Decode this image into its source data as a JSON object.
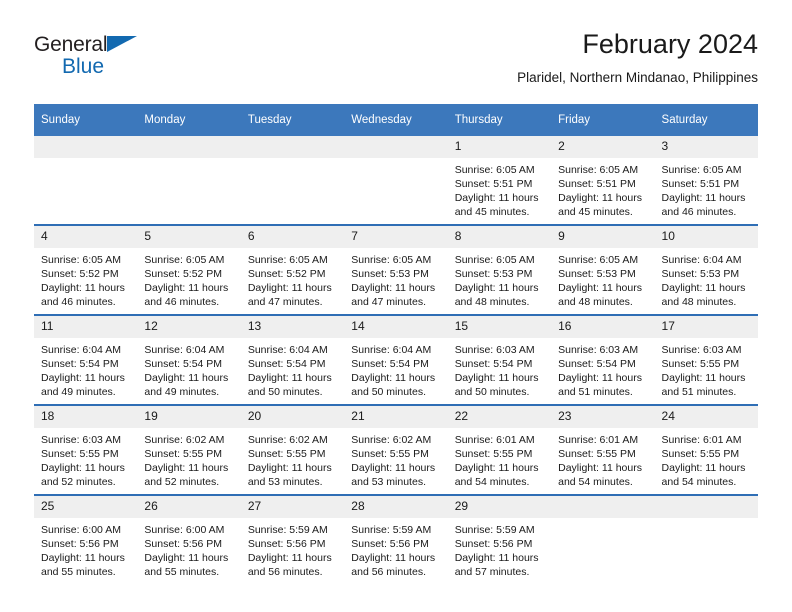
{
  "logo": {
    "name_top": "General",
    "name_bottom": "Blue",
    "triangle_color": "#1269b0"
  },
  "header": {
    "title": "February 2024",
    "subtitle": "Plaridel, Northern Mindanao, Philippines"
  },
  "theme": {
    "header_bar": "#3c78bc",
    "row_divider": "#2f6eb5",
    "date_band": "#efefef"
  },
  "calendar": {
    "weekday_headers": [
      "Sunday",
      "Monday",
      "Tuesday",
      "Wednesday",
      "Thursday",
      "Friday",
      "Saturday"
    ],
    "weeks": [
      [
        {
          "date": "",
          "empty": true
        },
        {
          "date": "",
          "empty": true
        },
        {
          "date": "",
          "empty": true
        },
        {
          "date": "",
          "empty": true
        },
        {
          "date": "1",
          "sunrise": "Sunrise: 6:05 AM",
          "sunset": "Sunset: 5:51 PM",
          "daylight": "Daylight: 11 hours and 45 minutes."
        },
        {
          "date": "2",
          "sunrise": "Sunrise: 6:05 AM",
          "sunset": "Sunset: 5:51 PM",
          "daylight": "Daylight: 11 hours and 45 minutes."
        },
        {
          "date": "3",
          "sunrise": "Sunrise: 6:05 AM",
          "sunset": "Sunset: 5:51 PM",
          "daylight": "Daylight: 11 hours and 46 minutes."
        }
      ],
      [
        {
          "date": "4",
          "sunrise": "Sunrise: 6:05 AM",
          "sunset": "Sunset: 5:52 PM",
          "daylight": "Daylight: 11 hours and 46 minutes."
        },
        {
          "date": "5",
          "sunrise": "Sunrise: 6:05 AM",
          "sunset": "Sunset: 5:52 PM",
          "daylight": "Daylight: 11 hours and 46 minutes."
        },
        {
          "date": "6",
          "sunrise": "Sunrise: 6:05 AM",
          "sunset": "Sunset: 5:52 PM",
          "daylight": "Daylight: 11 hours and 47 minutes."
        },
        {
          "date": "7",
          "sunrise": "Sunrise: 6:05 AM",
          "sunset": "Sunset: 5:53 PM",
          "daylight": "Daylight: 11 hours and 47 minutes."
        },
        {
          "date": "8",
          "sunrise": "Sunrise: 6:05 AM",
          "sunset": "Sunset: 5:53 PM",
          "daylight": "Daylight: 11 hours and 48 minutes."
        },
        {
          "date": "9",
          "sunrise": "Sunrise: 6:05 AM",
          "sunset": "Sunset: 5:53 PM",
          "daylight": "Daylight: 11 hours and 48 minutes."
        },
        {
          "date": "10",
          "sunrise": "Sunrise: 6:04 AM",
          "sunset": "Sunset: 5:53 PM",
          "daylight": "Daylight: 11 hours and 48 minutes."
        }
      ],
      [
        {
          "date": "11",
          "sunrise": "Sunrise: 6:04 AM",
          "sunset": "Sunset: 5:54 PM",
          "daylight": "Daylight: 11 hours and 49 minutes."
        },
        {
          "date": "12",
          "sunrise": "Sunrise: 6:04 AM",
          "sunset": "Sunset: 5:54 PM",
          "daylight": "Daylight: 11 hours and 49 minutes."
        },
        {
          "date": "13",
          "sunrise": "Sunrise: 6:04 AM",
          "sunset": "Sunset: 5:54 PM",
          "daylight": "Daylight: 11 hours and 50 minutes."
        },
        {
          "date": "14",
          "sunrise": "Sunrise: 6:04 AM",
          "sunset": "Sunset: 5:54 PM",
          "daylight": "Daylight: 11 hours and 50 minutes."
        },
        {
          "date": "15",
          "sunrise": "Sunrise: 6:03 AM",
          "sunset": "Sunset: 5:54 PM",
          "daylight": "Daylight: 11 hours and 50 minutes."
        },
        {
          "date": "16",
          "sunrise": "Sunrise: 6:03 AM",
          "sunset": "Sunset: 5:54 PM",
          "daylight": "Daylight: 11 hours and 51 minutes."
        },
        {
          "date": "17",
          "sunrise": "Sunrise: 6:03 AM",
          "sunset": "Sunset: 5:55 PM",
          "daylight": "Daylight: 11 hours and 51 minutes."
        }
      ],
      [
        {
          "date": "18",
          "sunrise": "Sunrise: 6:03 AM",
          "sunset": "Sunset: 5:55 PM",
          "daylight": "Daylight: 11 hours and 52 minutes."
        },
        {
          "date": "19",
          "sunrise": "Sunrise: 6:02 AM",
          "sunset": "Sunset: 5:55 PM",
          "daylight": "Daylight: 11 hours and 52 minutes."
        },
        {
          "date": "20",
          "sunrise": "Sunrise: 6:02 AM",
          "sunset": "Sunset: 5:55 PM",
          "daylight": "Daylight: 11 hours and 53 minutes."
        },
        {
          "date": "21",
          "sunrise": "Sunrise: 6:02 AM",
          "sunset": "Sunset: 5:55 PM",
          "daylight": "Daylight: 11 hours and 53 minutes."
        },
        {
          "date": "22",
          "sunrise": "Sunrise: 6:01 AM",
          "sunset": "Sunset: 5:55 PM",
          "daylight": "Daylight: 11 hours and 54 minutes."
        },
        {
          "date": "23",
          "sunrise": "Sunrise: 6:01 AM",
          "sunset": "Sunset: 5:55 PM",
          "daylight": "Daylight: 11 hours and 54 minutes."
        },
        {
          "date": "24",
          "sunrise": "Sunrise: 6:01 AM",
          "sunset": "Sunset: 5:55 PM",
          "daylight": "Daylight: 11 hours and 54 minutes."
        }
      ],
      [
        {
          "date": "25",
          "sunrise": "Sunrise: 6:00 AM",
          "sunset": "Sunset: 5:56 PM",
          "daylight": "Daylight: 11 hours and 55 minutes."
        },
        {
          "date": "26",
          "sunrise": "Sunrise: 6:00 AM",
          "sunset": "Sunset: 5:56 PM",
          "daylight": "Daylight: 11 hours and 55 minutes."
        },
        {
          "date": "27",
          "sunrise": "Sunrise: 5:59 AM",
          "sunset": "Sunset: 5:56 PM",
          "daylight": "Daylight: 11 hours and 56 minutes."
        },
        {
          "date": "28",
          "sunrise": "Sunrise: 5:59 AM",
          "sunset": "Sunset: 5:56 PM",
          "daylight": "Daylight: 11 hours and 56 minutes."
        },
        {
          "date": "29",
          "sunrise": "Sunrise: 5:59 AM",
          "sunset": "Sunset: 5:56 PM",
          "daylight": "Daylight: 11 hours and 57 minutes."
        },
        {
          "date": "",
          "empty": true
        },
        {
          "date": "",
          "empty": true
        }
      ]
    ]
  }
}
